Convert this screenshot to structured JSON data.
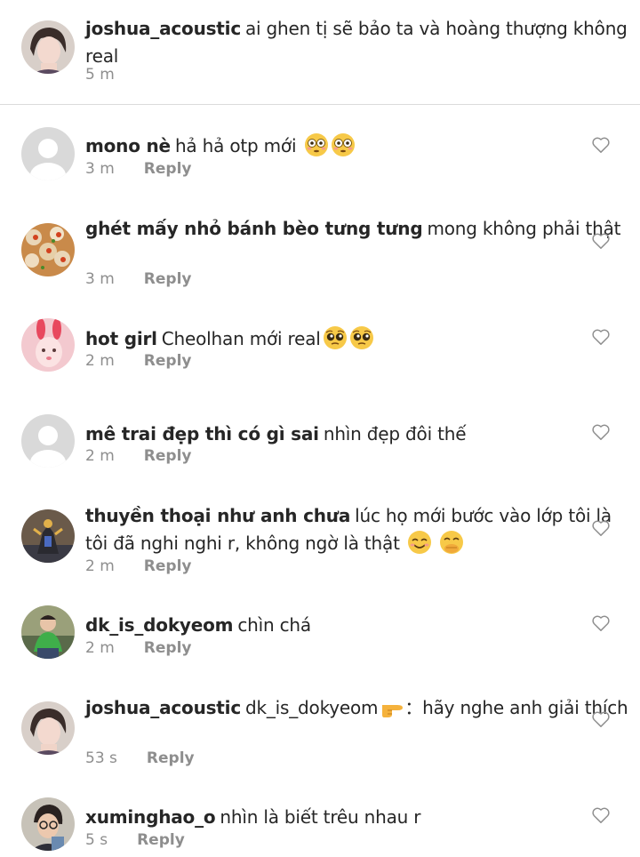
{
  "caption": {
    "username": "joshua_acoustic",
    "text": "ai ghen tị sẽ bảo ta và hoàng thượng không real",
    "time": "5 m"
  },
  "reply_label": "Reply",
  "comments": [
    {
      "username": "mono nè",
      "text": "hả hả otp mới",
      "time": "3 m",
      "avatar": "default-avatar"
    },
    {
      "username": "ghét mấy nhỏ bánh bèo tưng tưng",
      "text": "mong không phải thật",
      "time": "3 m",
      "avatar": "food-avatar"
    },
    {
      "username": "hot girl",
      "text": "Cheolhan mới real",
      "time": "2 m",
      "avatar": "bunny-filter-avatar"
    },
    {
      "username": "mê trai đẹp thì có gì sai",
      "text": "nhìn đẹp đôi thế",
      "time": "2 m",
      "avatar": "default-avatar"
    },
    {
      "username": "thuyền thoại như anh chưa",
      "text": "lúc họ mới bước vào lớp tôi là tôi đã nghi nghi r,  không ngờ là thật",
      "time": "2 m",
      "avatar": "figure-avatar"
    },
    {
      "username": "dk_is_dokyeom",
      "text": "chìn chá",
      "time": "2 m",
      "avatar": "green-shirt-avatar"
    },
    {
      "username": "joshua_acoustic",
      "text": "dk_is_dokyeom",
      "text_after": "：hãy nghe anh giải thích",
      "time": "53 s",
      "avatar": "man-avatar"
    },
    {
      "username": "xuminghao_o",
      "text": "nhìn là biết trêu nhau r",
      "time": "5 s",
      "avatar": "glasses-avatar"
    }
  ],
  "icons": {
    "heart": "heart-outline-icon",
    "flushed": "flushed-face-emoji",
    "pleading": "pleading-face-emoji",
    "smiling": "smiling-face-emoji",
    "hand_over_mouth": "face-with-hand-over-mouth-emoji",
    "pointing": "pointing-right-emoji"
  },
  "colors": {
    "text": "#262626",
    "meta": "#8e8e8e",
    "divider": "#dbdbdb",
    "default_avatar_bg": "#d9d9d9"
  }
}
